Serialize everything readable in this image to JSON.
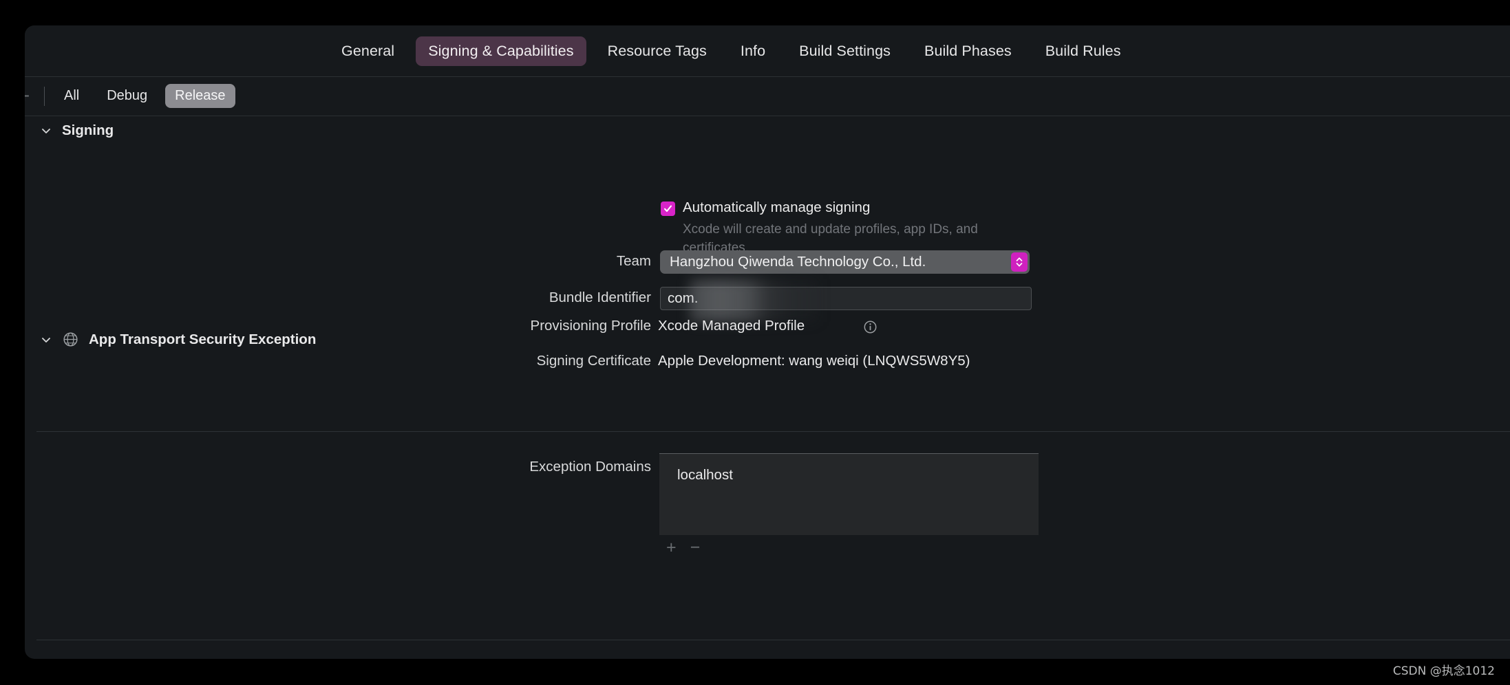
{
  "window": {
    "tabs": [
      {
        "label": "General",
        "selected": false
      },
      {
        "label": "Signing & Capabilities",
        "selected": true
      },
      {
        "label": "Resource Tags",
        "selected": false
      },
      {
        "label": "Info",
        "selected": false
      },
      {
        "label": "Build Settings",
        "selected": false
      },
      {
        "label": "Build Phases",
        "selected": false
      },
      {
        "label": "Build Rules",
        "selected": false
      }
    ],
    "config_bar": {
      "add_label": "+",
      "items": [
        {
          "label": "All",
          "selected": false
        },
        {
          "label": "Debug",
          "selected": false
        },
        {
          "label": "Release",
          "selected": true
        }
      ]
    }
  },
  "signing": {
    "section_title": "Signing",
    "disclosure_icon": "chevron-down-icon",
    "auto_manage": {
      "checked": true,
      "label": "Automatically manage signing",
      "description": "Xcode will create and update profiles, app IDs, and certificates."
    },
    "team": {
      "label": "Team",
      "value": "Hangzhou Qiwenda Technology Co., Ltd.",
      "control": "popup-button"
    },
    "bundle_identifier": {
      "label": "Bundle Identifier",
      "value": "com.",
      "redacted": true
    },
    "provisioning_profile": {
      "label": "Provisioning Profile",
      "value": "Xcode Managed Profile",
      "info_icon": "info-icon"
    },
    "signing_certificate": {
      "label": "Signing Certificate",
      "value": "Apple Development: wang weiqi (LNQWS5W8Y5)"
    }
  },
  "app_transport_security": {
    "section_title": "App Transport Security Exception",
    "disclosure_icon": "chevron-down-icon",
    "capability_icon": "globe-icon",
    "exception_domains": {
      "label": "Exception Domains",
      "items": [
        "localhost"
      ],
      "add_label": "+",
      "remove_label": "−"
    }
  },
  "watermark": {
    "text": "CSDN @执念1012"
  },
  "colors": {
    "accent_checkbox": "#d824c8",
    "accent_popup_arrows": "#cf21bf",
    "selected_tab_bg": "#4c3548",
    "selected_config_bg": "#8c8c91",
    "window_bg": "#16191c"
  }
}
